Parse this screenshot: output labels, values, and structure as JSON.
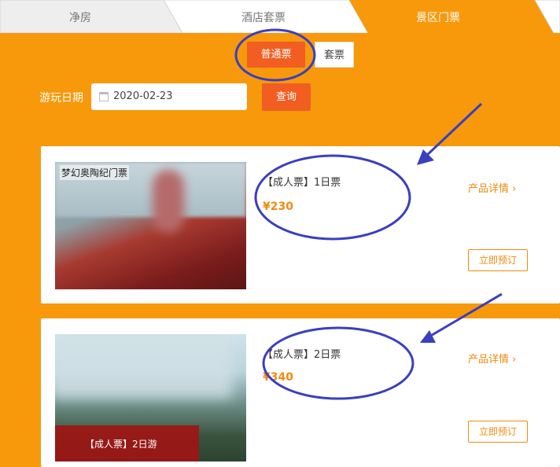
{
  "tabs": [
    {
      "label": "净房"
    },
    {
      "label": "酒店套票"
    },
    {
      "label": "景区门票"
    }
  ],
  "ticket_types": {
    "normal": "普通票",
    "package": "套票"
  },
  "date_filter": {
    "label": "游玩日期",
    "value": "2020-02-23",
    "query_button": "查询"
  },
  "products": [
    {
      "image_title": "梦幻奥陶纪门票",
      "name": "【成人票】1日票",
      "price": "¥230",
      "detail_link": "产品详情",
      "book_button": "立即预订"
    },
    {
      "image_banner": "【成人票】2日游",
      "name": "【成人票】2日票",
      "price": "¥340",
      "detail_link": "产品详情",
      "book_button": "立即预订"
    }
  ],
  "colors": {
    "background": "#f7990b",
    "accent": "#f25d22",
    "price": "#f08a10",
    "annotation": "#3a3fbf"
  }
}
